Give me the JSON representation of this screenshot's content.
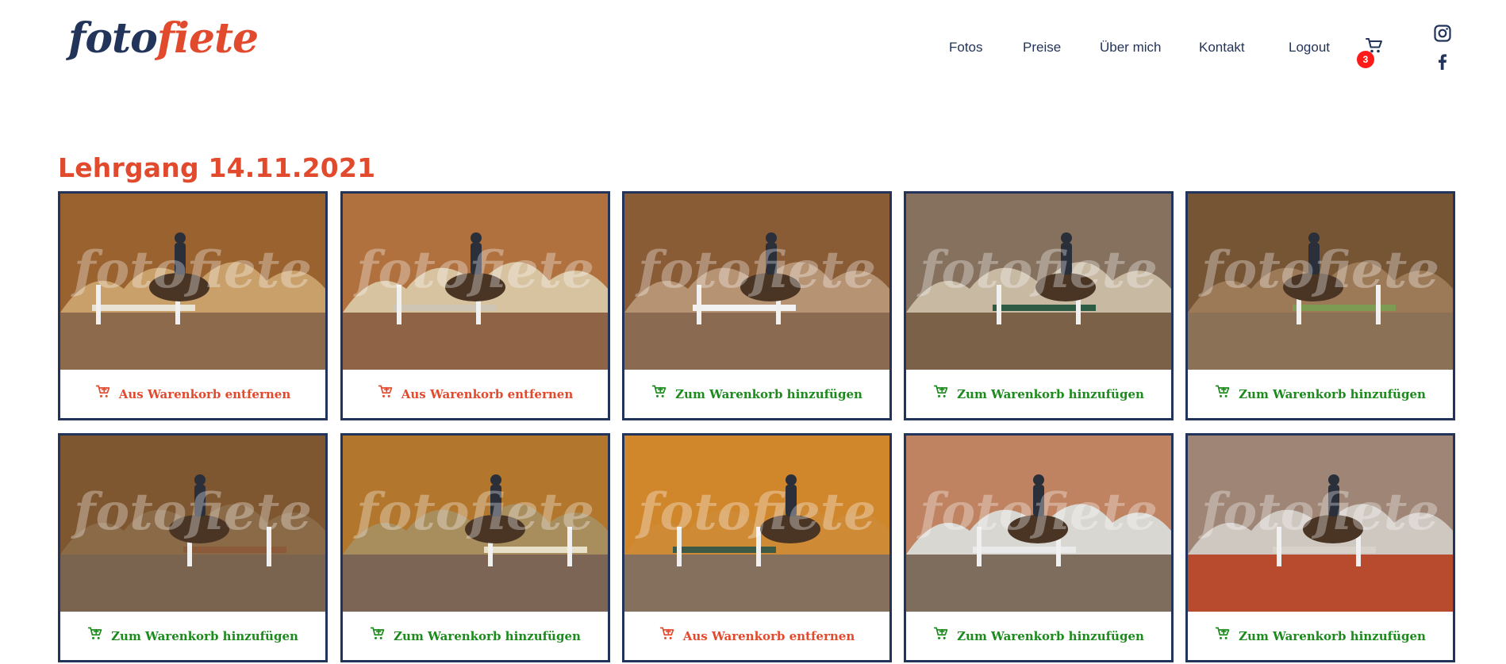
{
  "logo": {
    "part1": "foto",
    "part2": "fiete"
  },
  "nav": [
    {
      "label": "Fotos"
    },
    {
      "label": "Preise"
    },
    {
      "label": "Über mich"
    },
    {
      "label": "Kontakt"
    },
    {
      "label": "Logout"
    }
  ],
  "cart": {
    "count": "3",
    "icon": "cart-icon"
  },
  "social": {
    "instagram_icon": "instagram-icon",
    "facebook_icon": "facebook-icon"
  },
  "album": {
    "title": "Lehrgang 14.11.2021"
  },
  "watermark": "fotofiete",
  "colors": {
    "navy": "#23345a",
    "accent": "#e24a2e",
    "add_green": "#1d8a1d",
    "badge_red": "#ff1a1a"
  },
  "photos": [
    {
      "action": "remove",
      "label": "Aus Warenkorb entfernen"
    },
    {
      "action": "remove",
      "label": "Aus Warenkorb entfernen"
    },
    {
      "action": "add",
      "label": "Zum Warenkorb hinzufügen"
    },
    {
      "action": "add",
      "label": "Zum Warenkorb hinzufügen"
    },
    {
      "action": "add",
      "label": "Zum Warenkorb hinzufügen"
    },
    {
      "action": "add",
      "label": "Zum Warenkorb hinzufügen"
    },
    {
      "action": "add",
      "label": "Zum Warenkorb hinzufügen"
    },
    {
      "action": "remove",
      "label": "Aus Warenkorb entfernen"
    },
    {
      "action": "add",
      "label": "Zum Warenkorb hinzufügen"
    },
    {
      "action": "add",
      "label": "Zum Warenkorb hinzufügen"
    }
  ]
}
